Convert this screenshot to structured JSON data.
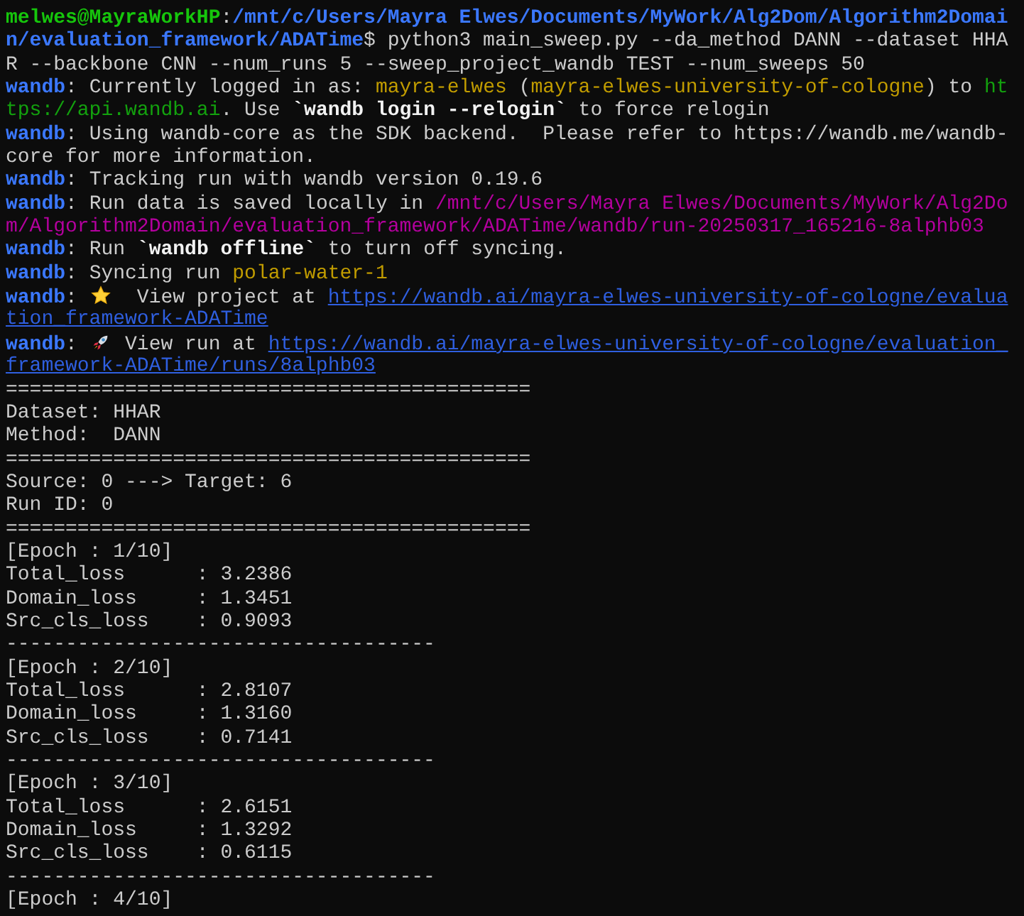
{
  "terminal": {
    "lines": [
      {
        "segments": [
          {
            "kind": "prompt_user",
            "text": "melwes@MayraWorkHP"
          },
          {
            "kind": "plain",
            "text": ":"
          },
          {
            "kind": "prompt_path",
            "text": "/mnt/c/Users/Mayra Elwes/Documents/MyWork/Alg2Dom/Algorithm2Domai"
          }
        ]
      },
      {
        "segments": [
          {
            "kind": "prompt_path",
            "text": "n/evaluation_framework/ADATime"
          },
          {
            "kind": "plain",
            "text": "$ python3 main_sweep.py --da_method DANN --dataset HHA"
          }
        ]
      },
      {
        "segments": [
          {
            "kind": "plain",
            "text": "R --backbone CNN --num_runs 5 --sweep_project_wandb TEST --num_sweeps 50"
          }
        ]
      },
      {
        "segments": [
          {
            "kind": "wandb_tag",
            "text": "wandb"
          },
          {
            "kind": "plain",
            "text": ": Currently logged in as: "
          },
          {
            "kind": "name_highlight",
            "text": "mayra-elwes"
          },
          {
            "kind": "plain",
            "text": " ("
          },
          {
            "kind": "name_highlight",
            "text": "mayra-elwes-university-of-cologne"
          },
          {
            "kind": "plain",
            "text": ") to "
          },
          {
            "kind": "url_plain",
            "text": "ht"
          }
        ]
      },
      {
        "segments": [
          {
            "kind": "url_plain",
            "text": "tps://api.wandb.ai"
          },
          {
            "kind": "plain",
            "text": ". Use "
          },
          {
            "kind": "command_bold",
            "text": "`wandb login --relogin`"
          },
          {
            "kind": "plain",
            "text": " to force relogin"
          }
        ]
      },
      {
        "segments": [
          {
            "kind": "wandb_tag",
            "text": "wandb"
          },
          {
            "kind": "plain",
            "text": ": Using wandb-core as the SDK backend.  Please refer to https://wandb.me/wandb-"
          }
        ]
      },
      {
        "segments": [
          {
            "kind": "plain",
            "text": "core for more information."
          }
        ]
      },
      {
        "segments": [
          {
            "kind": "wandb_tag",
            "text": "wandb"
          },
          {
            "kind": "plain",
            "text": ": Tracking run with wandb version 0.19.6"
          }
        ]
      },
      {
        "segments": [
          {
            "kind": "wandb_tag",
            "text": "wandb"
          },
          {
            "kind": "plain",
            "text": ": Run data is saved locally in "
          },
          {
            "kind": "file_path",
            "text": "/mnt/c/Users/Mayra Elwes/Documents/MyWork/Alg2Do"
          }
        ]
      },
      {
        "segments": [
          {
            "kind": "file_path",
            "text": "m/Algorithm2Domain/evaluation_framework/ADATime/wandb/run-20250317_165216-8alphb03"
          }
        ]
      },
      {
        "segments": [
          {
            "kind": "wandb_tag",
            "text": "wandb"
          },
          {
            "kind": "plain",
            "text": ": Run "
          },
          {
            "kind": "command_bold",
            "text": "`wandb offline`"
          },
          {
            "kind": "plain",
            "text": " to turn off syncing."
          }
        ]
      },
      {
        "segments": [
          {
            "kind": "wandb_tag",
            "text": "wandb"
          },
          {
            "kind": "plain",
            "text": ": Syncing run "
          },
          {
            "kind": "name_highlight",
            "text": "polar-water-1"
          }
        ]
      },
      {
        "segments": [
          {
            "kind": "wandb_tag",
            "text": "wandb"
          },
          {
            "kind": "plain",
            "text": ": "
          },
          {
            "kind": "star_icon"
          },
          {
            "kind": "plain",
            "text": "  View project at "
          },
          {
            "kind": "link",
            "text": "https://wandb.ai/mayra-elwes-university-of-cologne/evalua"
          }
        ]
      },
      {
        "segments": [
          {
            "kind": "link",
            "text": "tion_framework-ADATime"
          }
        ]
      },
      {
        "segments": [
          {
            "kind": "wandb_tag",
            "text": "wandb"
          },
          {
            "kind": "plain",
            "text": ": "
          },
          {
            "kind": "rocket_icon"
          },
          {
            "kind": "plain",
            "text": " View run at "
          },
          {
            "kind": "link",
            "text": "https://wandb.ai/mayra-elwes-university-of-cologne/evaluation_"
          }
        ]
      },
      {
        "segments": [
          {
            "kind": "link",
            "text": "framework-ADATime/runs/8alphb03"
          }
        ]
      },
      {
        "segments": [
          {
            "kind": "plain",
            "text": "============================================"
          }
        ]
      },
      {
        "segments": [
          {
            "kind": "plain",
            "text": "Dataset: HHAR"
          }
        ]
      },
      {
        "segments": [
          {
            "kind": "plain",
            "text": "Method:  DANN"
          }
        ]
      },
      {
        "segments": [
          {
            "kind": "plain",
            "text": "============================================"
          }
        ]
      },
      {
        "segments": [
          {
            "kind": "plain",
            "text": "Source: 0 ---> Target: 6"
          }
        ]
      },
      {
        "segments": [
          {
            "kind": "plain",
            "text": "Run ID: 0"
          }
        ]
      },
      {
        "segments": [
          {
            "kind": "plain",
            "text": "============================================"
          }
        ]
      },
      {
        "segments": [
          {
            "kind": "plain",
            "text": "[Epoch : 1/10]"
          }
        ]
      },
      {
        "segments": [
          {
            "kind": "plain",
            "text": "Total_loss      : 3.2386"
          }
        ]
      },
      {
        "segments": [
          {
            "kind": "plain",
            "text": "Domain_loss     : 1.3451"
          }
        ]
      },
      {
        "segments": [
          {
            "kind": "plain",
            "text": "Src_cls_loss    : 0.9093"
          }
        ]
      },
      {
        "segments": [
          {
            "kind": "plain",
            "text": "------------------------------------"
          }
        ]
      },
      {
        "segments": [
          {
            "kind": "plain",
            "text": "[Epoch : 2/10]"
          }
        ]
      },
      {
        "segments": [
          {
            "kind": "plain",
            "text": "Total_loss      : 2.8107"
          }
        ]
      },
      {
        "segments": [
          {
            "kind": "plain",
            "text": "Domain_loss     : 1.3160"
          }
        ]
      },
      {
        "segments": [
          {
            "kind": "plain",
            "text": "Src_cls_loss    : 0.7141"
          }
        ]
      },
      {
        "segments": [
          {
            "kind": "plain",
            "text": "------------------------------------"
          }
        ]
      },
      {
        "segments": [
          {
            "kind": "plain",
            "text": "[Epoch : 3/10]"
          }
        ]
      },
      {
        "segments": [
          {
            "kind": "plain",
            "text": "Total_loss      : 2.6151"
          }
        ]
      },
      {
        "segments": [
          {
            "kind": "plain",
            "text": "Domain_loss     : 1.3292"
          }
        ]
      },
      {
        "segments": [
          {
            "kind": "plain",
            "text": "Src_cls_loss    : 0.6115"
          }
        ]
      },
      {
        "segments": [
          {
            "kind": "plain",
            "text": "------------------------------------"
          }
        ]
      },
      {
        "segments": [
          {
            "kind": "plain",
            "text": "[Epoch : 4/10]"
          }
        ]
      }
    ]
  }
}
